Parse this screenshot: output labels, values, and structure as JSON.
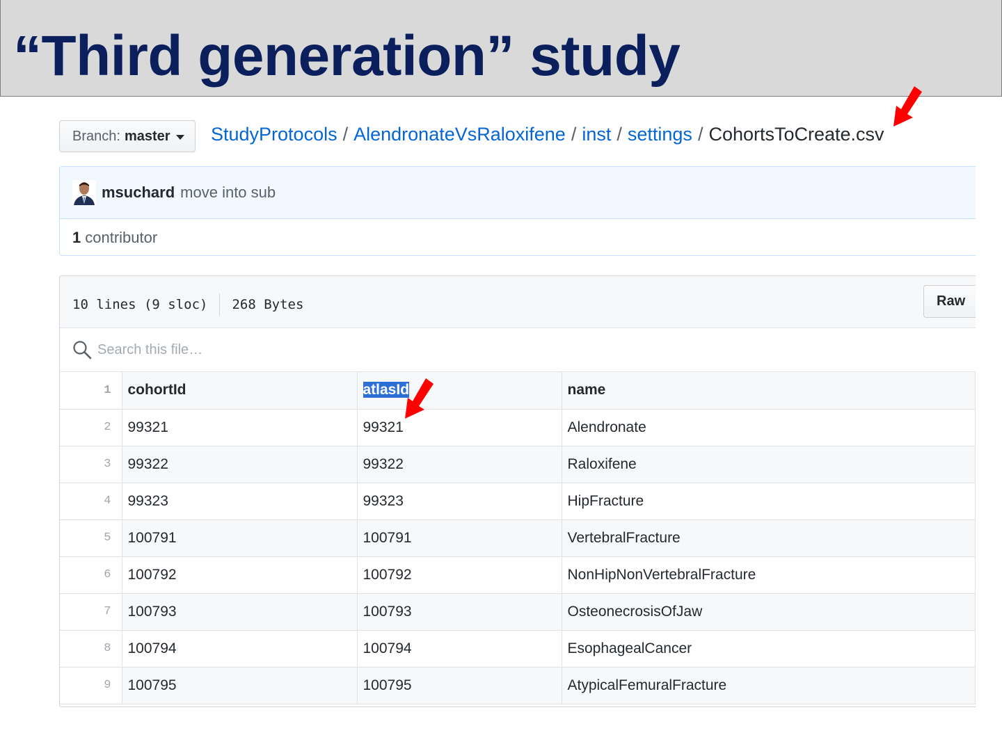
{
  "slide": {
    "title": "“Third generation” study"
  },
  "branch": {
    "label": "Branch:",
    "value": "master"
  },
  "breadcrumb": {
    "items": [
      "StudyProtocols",
      "AlendronateVsRaloxifene",
      "inst",
      "settings"
    ],
    "separator": "/",
    "current": "CohortsToCreate.csv"
  },
  "commit": {
    "author": "msuchard",
    "message": "move into sub"
  },
  "contributors": {
    "count": "1",
    "label": "contributor"
  },
  "file": {
    "lines": "10 lines (9 sloc)",
    "size": "268 Bytes",
    "raw_label": "Raw",
    "search_placeholder": "Search this file…"
  },
  "table": {
    "headers": [
      "cohortId",
      "atlasId",
      "name"
    ],
    "line_numbers": [
      "1",
      "2",
      "3",
      "4",
      "5",
      "6",
      "7",
      "8",
      "9"
    ],
    "rows": [
      [
        "99321",
        "99321",
        "Alendronate"
      ],
      [
        "99322",
        "99322",
        "Raloxifene"
      ],
      [
        "99323",
        "99323",
        "HipFracture"
      ],
      [
        "100791",
        "100791",
        "VertebralFracture"
      ],
      [
        "100792",
        "100792",
        "NonHipNonVertebralFracture"
      ],
      [
        "100793",
        "100793",
        "OsteonecrosisOfJaw"
      ],
      [
        "100794",
        "100794",
        "EsophagealCancer"
      ],
      [
        "100795",
        "100795",
        "AtypicalFemuralFracture"
      ]
    ]
  },
  "colors": {
    "title": "#0a1f5c",
    "link": "#0366d6",
    "arrow": "#ff0000",
    "highlight": "#2e6fd6"
  },
  "icons": {
    "arrow": "red-arrow-icon",
    "search": "search-icon",
    "caret": "caret-down-icon"
  }
}
